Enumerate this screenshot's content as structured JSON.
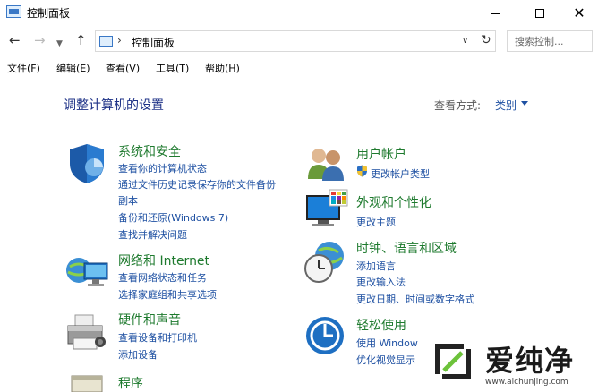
{
  "window": {
    "title": "控制面板"
  },
  "address_bar": {
    "breadcrumb": "控制面板",
    "separator": "›",
    "search_placeholder": "搜索控制..."
  },
  "menu": [
    "文件(F)",
    "编辑(E)",
    "查看(V)",
    "工具(T)",
    "帮助(H)"
  ],
  "main": {
    "heading": "调整计算机的设置",
    "view_by_label": "查看方式:",
    "view_by_value": "类别"
  },
  "categories": {
    "system_security": {
      "title": "系统和安全",
      "links": [
        "查看你的计算机状态",
        "通过文件历史记录保存你的文件备份",
        "副本",
        "备份和还原(Windows 7)",
        "查找并解决问题"
      ]
    },
    "network": {
      "title": "网络和 Internet",
      "links": [
        "查看网络状态和任务",
        "选择家庭组和共享选项"
      ]
    },
    "hardware": {
      "title": "硬件和声音",
      "links": [
        "查看设备和打印机",
        "添加设备"
      ]
    },
    "programs": {
      "title": "程序"
    },
    "user_accounts": {
      "title": "用户帐户",
      "links": [
        "更改帐户类型"
      ]
    },
    "appearance": {
      "title": "外观和个性化",
      "links": [
        "更改主题"
      ]
    },
    "clock_region": {
      "title": "时钟、语言和区域",
      "links": [
        "添加语言",
        "更改输入法",
        "更改日期、时间或数字格式"
      ]
    },
    "ease_access": {
      "title": "轻松使用",
      "links": [
        "使用 Window",
        "优化视觉显示"
      ]
    }
  },
  "watermark": {
    "text": "爱纯净",
    "url": "www.aichunjing.com"
  },
  "colors": {
    "category_title": "#1e7a2e",
    "link": "#1e50a2",
    "heading": "#1e3287"
  }
}
